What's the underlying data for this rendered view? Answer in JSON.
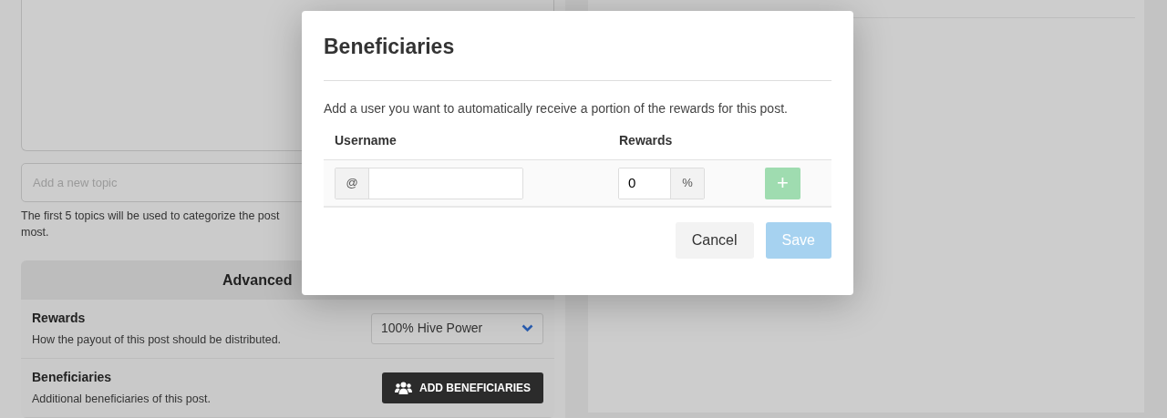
{
  "editor": {
    "topic_field": {
      "placeholder": "Add a new topic"
    },
    "topic_help": [
      "The first 5 topics will be used to categorize the post",
      "most."
    ]
  },
  "advanced": {
    "title": "Advanced",
    "settings": [
      {
        "kind": "select",
        "label": "Rewards",
        "description": "How the payout of this post should be distributed.",
        "value": "100% Hive Power"
      },
      {
        "kind": "button",
        "label": "Beneficiaries",
        "description": "Additional beneficiaries of this post.",
        "button": "ADD BENEFICIARIES"
      }
    ]
  },
  "modal": {
    "title": "Beneficiaries",
    "description": "Add a user you want to automatically receive a portion of the rewards for this post.",
    "columns": [
      "Username",
      "Rewards"
    ],
    "row": {
      "prefix": "@",
      "reward": "0",
      "suffix": "%",
      "add_button": {
        "label": "+",
        "disabled": true
      }
    },
    "buttons": [
      {
        "label": "Cancel",
        "kind": "secondary",
        "disabled": false
      },
      {
        "label": "Save",
        "kind": "primary",
        "disabled": true
      }
    ]
  }
}
